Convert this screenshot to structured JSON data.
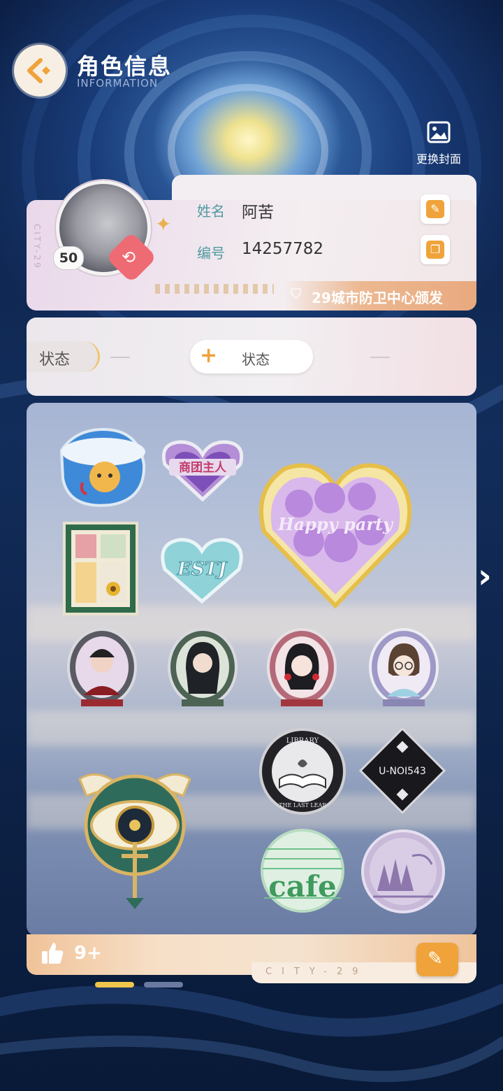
{
  "header": {
    "title": "角色信息",
    "subtitle": "INFORMATION",
    "back_icon": "back-arrow-icon"
  },
  "cover": {
    "label": "更换封面",
    "icon": "image-icon"
  },
  "profile": {
    "card_vertical_text": "CITY-29",
    "level": "50",
    "name_label": "姓名",
    "name_value": "阿苦",
    "id_label": "编号",
    "id_value": "14257782",
    "issuer": "29城市防卫中心颁发"
  },
  "status": {
    "tab_label": "状态",
    "add_label": "状态"
  },
  "badges": {
    "items": [
      {
        "name": "rain-cat-badge"
      },
      {
        "name": "guild-master-badge",
        "text": "商团主人"
      },
      {
        "name": "happy-party-badge",
        "text": "Happy party"
      },
      {
        "name": "flower-frame-badge"
      },
      {
        "name": "estj-heart-badge",
        "text": "ESTJ"
      },
      {
        "name": "portrait-man-badge"
      },
      {
        "name": "portrait-longhair-badge"
      },
      {
        "name": "portrait-girl-badge"
      },
      {
        "name": "portrait-glasses-badge"
      },
      {
        "name": "eye-wings-badge"
      },
      {
        "name": "library-badge",
        "text_top": "LIBRARY",
        "text_bottom": "THE LAST LEAF"
      },
      {
        "name": "unoise-badge",
        "text": "U-NOI543"
      },
      {
        "name": "cafe-badge",
        "text": "cafe"
      },
      {
        "name": "forest-badge"
      }
    ]
  },
  "footer": {
    "like_count": "9+",
    "city_text": "CITY-29"
  },
  "colors": {
    "accent": "#f0a33a",
    "teal_label": "#4f9aa0",
    "switch_red": "#ef6b73"
  }
}
